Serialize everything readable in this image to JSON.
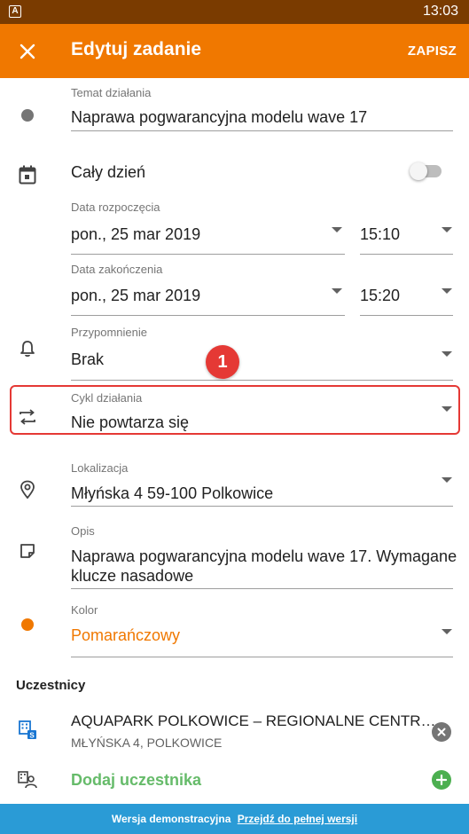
{
  "status_bar": {
    "app_badge": "A",
    "time": "13:03"
  },
  "app_bar": {
    "title": "Edytuj zadanie",
    "save_label": "ZAPISZ"
  },
  "subject": {
    "label": "Temat działania",
    "value": "Naprawa pogwarancyjna modelu wave 17"
  },
  "all_day": {
    "label": "Cały dzień",
    "enabled": false
  },
  "start": {
    "label": "Data rozpoczęcia",
    "date": "pon., 25 mar 2019",
    "time": "15:10"
  },
  "end": {
    "label": "Data zakończenia",
    "date": "pon., 25 mar 2019",
    "time": "15:20"
  },
  "reminder": {
    "label": "Przypomnienie",
    "value": "Brak"
  },
  "recurrence": {
    "label": "Cykl działania",
    "value": "Nie powtarza się"
  },
  "annotation_marker": "1",
  "location": {
    "label": "Lokalizacja",
    "value": "Młyńska 4 59-100 Polkowice"
  },
  "description": {
    "label": "Opis",
    "line1": "Naprawa pogwarancyjna modelu wave 17. Wymagane",
    "line2": "klucze nasadowe"
  },
  "color": {
    "label": "Kolor",
    "value": "Pomarańczowy",
    "hex": "#f07800"
  },
  "participants": {
    "title": "Uczestnicy",
    "items": [
      {
        "name": "AQUAPARK POLKOWICE – REGIONALNE CENTR…",
        "address": "MŁYŃSKA 4, POLKOWICE"
      }
    ],
    "add_label": "Dodaj uczestnika"
  },
  "footer": {
    "text": "Wersja demonstracyjna",
    "link": "Przejdź do pełnej wersji"
  },
  "colors": {
    "accent": "#f07800",
    "status_bar": "#7a3b00",
    "footer": "#2a9bd6",
    "highlight": "#e53935",
    "add_green": "#4caf50"
  }
}
